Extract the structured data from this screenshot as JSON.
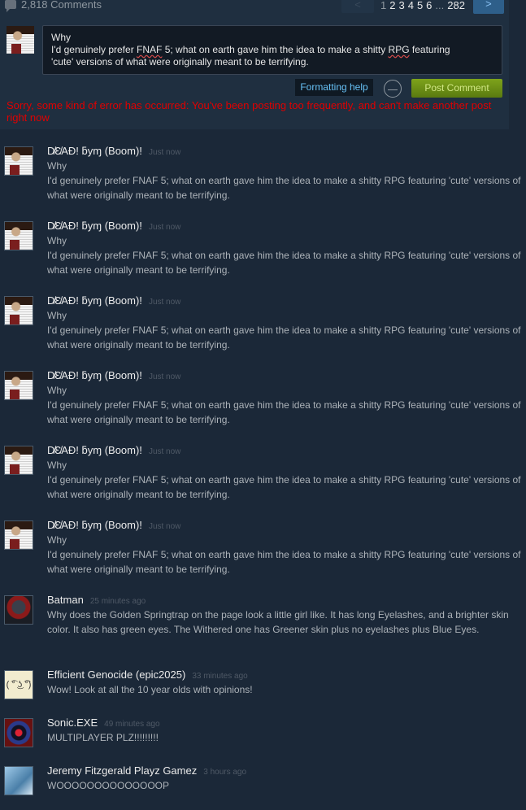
{
  "header": {
    "comment_count": "2,818 Comments",
    "pagination": {
      "prev_label": "<",
      "pages": [
        "1",
        "2",
        "3",
        "4",
        "5",
        "6"
      ],
      "ellipsis": "...",
      "last_page": "282",
      "next_label": ">"
    }
  },
  "entry": {
    "text_line1": "Why",
    "text_line2_a": "I'd genuinely prefer ",
    "text_line2_fnaf": "FNAF",
    "text_line2_b": " 5; what on earth gave him the idea to make a shitty ",
    "text_line2_rpg": "RPG",
    "text_line2_c": " featuring",
    "text_line3": "'cute' versions of what were originally meant to be terrifying.",
    "formatting_help_label": "Formatting help",
    "post_button_label": "Post Comment",
    "error_message": "Sorry, some kind of error has occurred: You've been posting too frequently, and can't make another post right now"
  },
  "comments": [
    {
      "author": "D̸Ɛ̸ΑĐ! ƃуɱ (Boom)!",
      "time": "Just now",
      "line1": "Why",
      "line2": "I'd genuinely prefer FNAF 5; what on earth gave him the idea to make a shitty RPG featuring 'cute' versions of what were originally meant to be terrifying."
    },
    {
      "author": "D̸Ɛ̸ΑĐ! ƃуɱ (Boom)!",
      "time": "Just now",
      "line1": "Why",
      "line2": "I'd genuinely prefer FNAF 5; what on earth gave him the idea to make a shitty RPG featuring 'cute' versions of what were originally meant to be terrifying."
    },
    {
      "author": "D̸Ɛ̸ΑĐ! ƃуɱ (Boom)!",
      "time": "Just now",
      "line1": "Why",
      "line2": "I'd genuinely prefer FNAF 5; what on earth gave him the idea to make a shitty RPG featuring 'cute' versions of what were originally meant to be terrifying."
    },
    {
      "author": "D̸Ɛ̸ΑĐ! ƃуɱ (Boom)!",
      "time": "Just now",
      "line1": "Why",
      "line2": "I'd genuinely prefer FNAF 5; what on earth gave him the idea to make a shitty RPG featuring 'cute' versions of what were originally meant to be terrifying."
    },
    {
      "author": "D̸Ɛ̸ΑĐ! ƃуɱ (Boom)!",
      "time": "Just now",
      "line1": "Why",
      "line2": "I'd genuinely prefer FNAF 5; what on earth gave him the idea to make a shitty RPG featuring 'cute' versions of what were originally meant to be terrifying."
    },
    {
      "author": "D̸Ɛ̸ΑĐ! ƃуɱ (Boom)!",
      "time": "Just now",
      "line1": "Why",
      "line2": "I'd genuinely prefer FNAF 5; what on earth gave him the idea to make a shitty RPG featuring 'cute' versions of what were originally meant to be terrifying."
    },
    {
      "author": "Batman",
      "time": "25 minutes ago",
      "line1": "Why does the Golden Springtrap on the page look a little girl like. It has long Eyelashes, and a brighter skin color. It also has green eyes. The Withered one has Greener skin plus no eyelashes plus Blue Eyes.",
      "line2": ""
    },
    {
      "author": "Efficient Genocide (epic2025)",
      "time": "33 minutes ago",
      "line1": "Wow! Look at all the 10 year olds with opinions!",
      "line2": ""
    },
    {
      "author": "Sonic.EXE",
      "time": "49 minutes ago",
      "line1": "MULTIPLAYER PLZ!!!!!!!!!",
      "line2": ""
    },
    {
      "author": "Jeremy Fitzgerald Playz Gamez",
      "time": "3 hours ago",
      "line1": "WOOOOOOOOOOOOOOP",
      "line2": ""
    }
  ]
}
